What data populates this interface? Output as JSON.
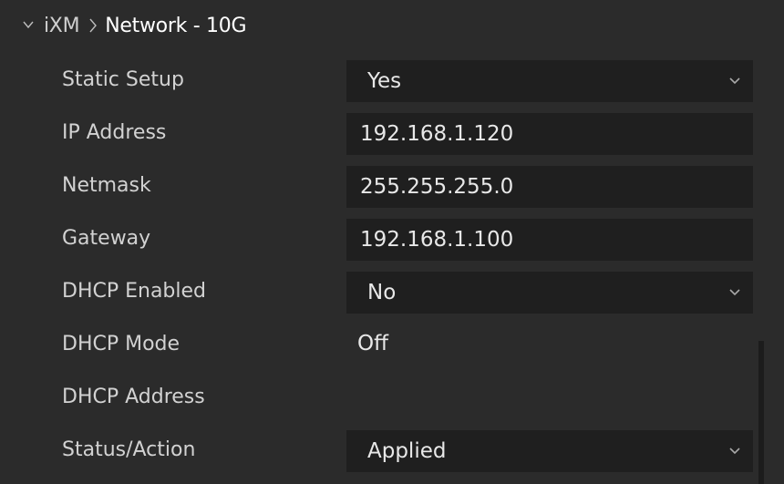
{
  "header": {
    "parent": "iXM",
    "title": "Network - 10G",
    "collapse_icon": "chevron-down-icon",
    "separator_icon": "chevron-right-icon"
  },
  "rows": [
    {
      "label": "Static Setup",
      "type": "select",
      "value": "Yes"
    },
    {
      "label": "IP Address",
      "type": "input",
      "value": "192.168.1.120"
    },
    {
      "label": "Netmask",
      "type": "input",
      "value": "255.255.255.0"
    },
    {
      "label": "Gateway",
      "type": "input",
      "value": "192.168.1.100"
    },
    {
      "label": "DHCP Enabled",
      "type": "select",
      "value": "No"
    },
    {
      "label": "DHCP Mode",
      "type": "static",
      "value": "Off"
    },
    {
      "label": "DHCP Address",
      "type": "static",
      "value": ""
    },
    {
      "label": "Status/Action",
      "type": "select",
      "value": "Applied"
    }
  ],
  "colors": {
    "panel_bg": "#2b2b2b",
    "field_bg": "#1f1f1f",
    "label_text": "#d2d2d2",
    "value_text": "#e8e8e8",
    "title_text": "#ffffff"
  }
}
